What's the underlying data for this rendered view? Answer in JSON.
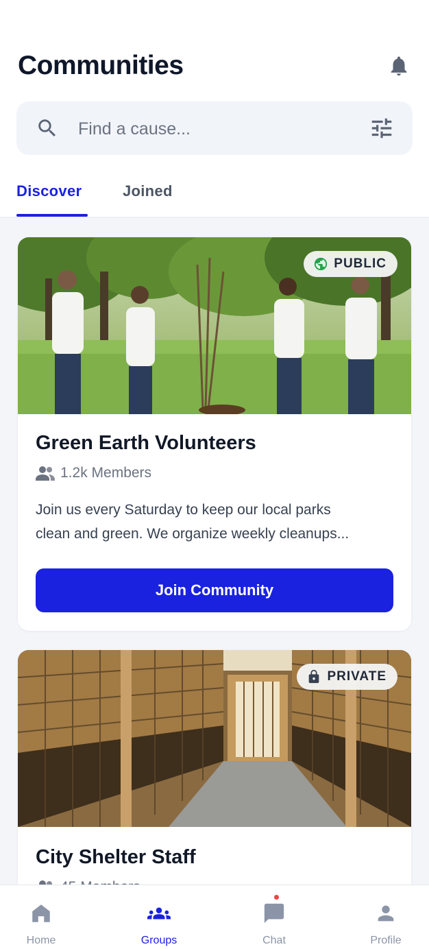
{
  "header": {
    "title": "Communities"
  },
  "search": {
    "placeholder": "Find a cause..."
  },
  "tabs": [
    {
      "label": "Discover",
      "active": true
    },
    {
      "label": "Joined",
      "active": false
    }
  ],
  "communities": [
    {
      "name": "Green Earth Volunteers",
      "visibility": "PUBLIC",
      "visibility_icon": "globe-icon",
      "members": "1.2k Members",
      "description_lines": [
        "Join us every Saturday to keep our local parks",
        "clean and green. We organize weekly cleanups..."
      ],
      "action_label": "Join Community"
    },
    {
      "name": "City Shelter Staff",
      "visibility": "PRIVATE",
      "visibility_icon": "lock-icon",
      "members": "45 Members"
    }
  ],
  "bottom_nav": [
    {
      "label": "Home",
      "icon": "home-icon",
      "active": false
    },
    {
      "label": "Groups",
      "icon": "groups-icon",
      "active": true
    },
    {
      "label": "Chat",
      "icon": "chat-icon",
      "active": false,
      "has_notification": true
    },
    {
      "label": "Profile",
      "icon": "profile-icon",
      "active": false
    }
  ],
  "colors": {
    "accent": "#1a22e0",
    "public_badge_icon": "#22a34a",
    "notification": "#ef4444"
  }
}
